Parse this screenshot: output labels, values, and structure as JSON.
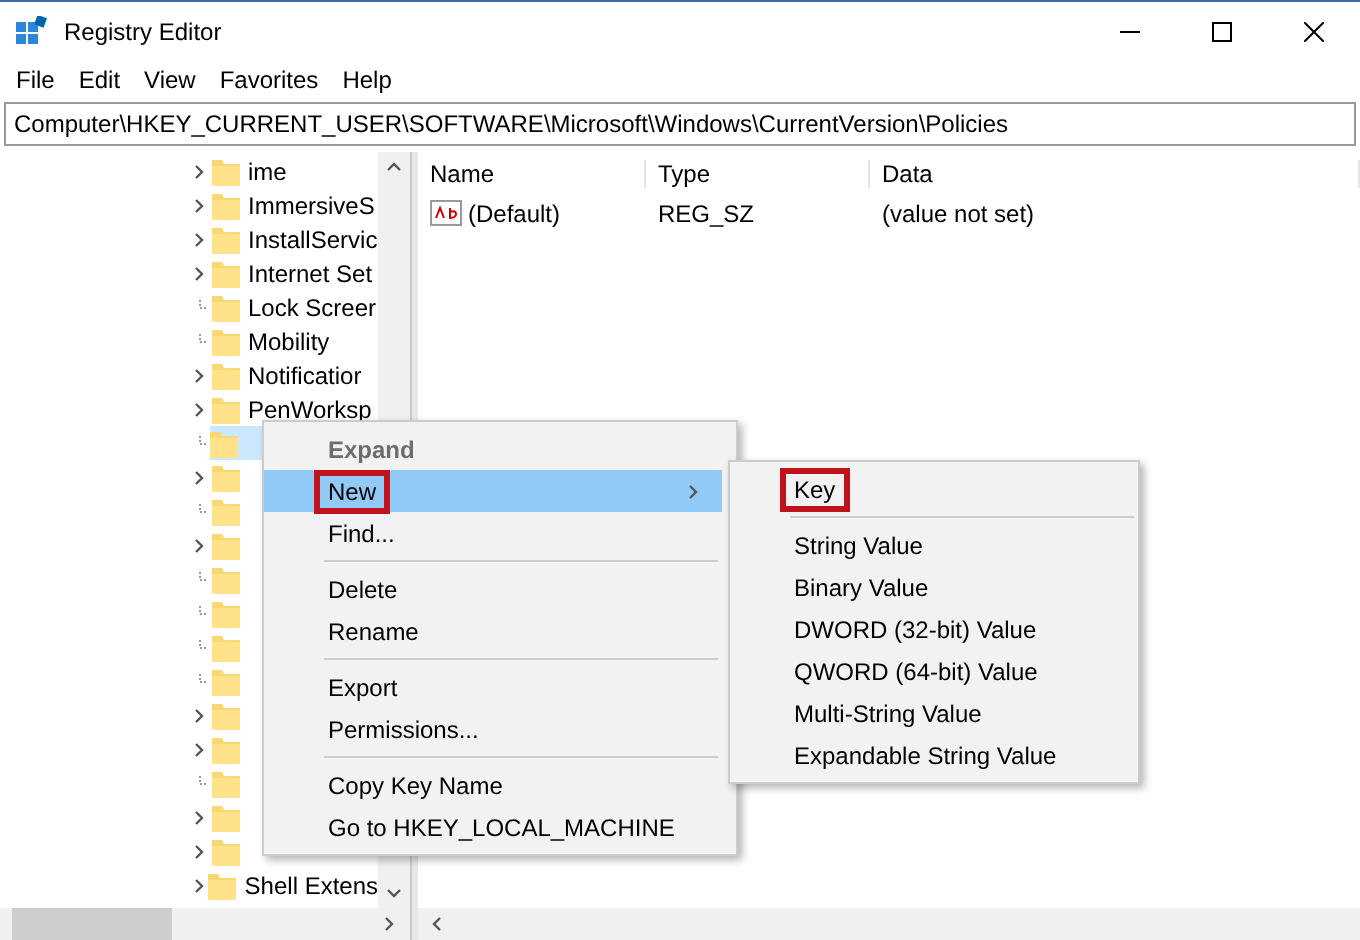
{
  "window": {
    "title": "Registry Editor"
  },
  "menu_bar": [
    "File",
    "Edit",
    "View",
    "Favorites",
    "Help"
  ],
  "address": "Computer\\HKEY_CURRENT_USER\\SOFTWARE\\Microsoft\\Windows\\CurrentVersion\\Policies",
  "tree": [
    {
      "label": "ime",
      "expandable": true,
      "selected": false
    },
    {
      "label": "ImmersiveS",
      "expandable": true,
      "selected": false
    },
    {
      "label": "InstallServic",
      "expandable": true,
      "selected": false
    },
    {
      "label": "Internet Set",
      "expandable": true,
      "selected": false
    },
    {
      "label": "Lock Screer",
      "expandable": false,
      "selected": false
    },
    {
      "label": "Mobility",
      "expandable": false,
      "selected": false
    },
    {
      "label": "Notificatior",
      "expandable": true,
      "selected": false
    },
    {
      "label": "PenWorksp",
      "expandable": true,
      "selected": false
    },
    {
      "expandable": false,
      "selected": true
    },
    {
      "expandable": true,
      "selected": false
    },
    {
      "expandable": false,
      "selected": false
    },
    {
      "expandable": true,
      "selected": false
    },
    {
      "expandable": false,
      "selected": false
    },
    {
      "expandable": false,
      "selected": false
    },
    {
      "expandable": false,
      "selected": false
    },
    {
      "expandable": false,
      "selected": false
    },
    {
      "expandable": true,
      "selected": false
    },
    {
      "expandable": true,
      "selected": false
    },
    {
      "expandable": false,
      "selected": false
    },
    {
      "expandable": true,
      "selected": false
    },
    {
      "expandable": true,
      "selected": false
    },
    {
      "label": "Shell Extens",
      "expandable": true,
      "selected": false
    }
  ],
  "values_table": {
    "columns": [
      "Name",
      "Type",
      "Data"
    ],
    "rows": [
      {
        "name": "(Default)",
        "type": "REG_SZ",
        "data": "(value not set)"
      }
    ]
  },
  "context_menu": [
    {
      "kind": "item",
      "label": "Expand",
      "disabled": true,
      "bold": true,
      "highlighted": false,
      "outlined": false
    },
    {
      "kind": "submenu",
      "label": "New",
      "disabled": false,
      "bold": false,
      "highlighted": true,
      "outlined": true
    },
    {
      "kind": "item",
      "label": "Find...",
      "disabled": false,
      "bold": false,
      "highlighted": false,
      "outlined": false
    },
    {
      "kind": "separator"
    },
    {
      "kind": "item",
      "label": "Delete",
      "disabled": false,
      "bold": false,
      "highlighted": false,
      "outlined": false
    },
    {
      "kind": "item",
      "label": "Rename",
      "disabled": false,
      "bold": false,
      "highlighted": false,
      "outlined": false
    },
    {
      "kind": "separator"
    },
    {
      "kind": "item",
      "label": "Export",
      "disabled": false,
      "bold": false,
      "highlighted": false,
      "outlined": false
    },
    {
      "kind": "item",
      "label": "Permissions...",
      "disabled": false,
      "bold": false,
      "highlighted": false,
      "outlined": false
    },
    {
      "kind": "separator"
    },
    {
      "kind": "item",
      "label": "Copy Key Name",
      "disabled": false,
      "bold": false,
      "highlighted": false,
      "outlined": false
    },
    {
      "kind": "item",
      "label": "Go to HKEY_LOCAL_MACHINE",
      "disabled": false,
      "bold": false,
      "highlighted": false,
      "outlined": false
    }
  ],
  "submenu": [
    {
      "kind": "item",
      "label": "Key",
      "outlined": true
    },
    {
      "kind": "separator"
    },
    {
      "kind": "item",
      "label": "String Value",
      "outlined": false
    },
    {
      "kind": "item",
      "label": "Binary Value",
      "outlined": false
    },
    {
      "kind": "item",
      "label": "DWORD (32-bit) Value",
      "outlined": false
    },
    {
      "kind": "item",
      "label": "QWORD (64-bit) Value",
      "outlined": false
    },
    {
      "kind": "item",
      "label": "Multi-String Value",
      "outlined": false
    },
    {
      "kind": "item",
      "label": "Expandable String Value",
      "outlined": false
    }
  ]
}
